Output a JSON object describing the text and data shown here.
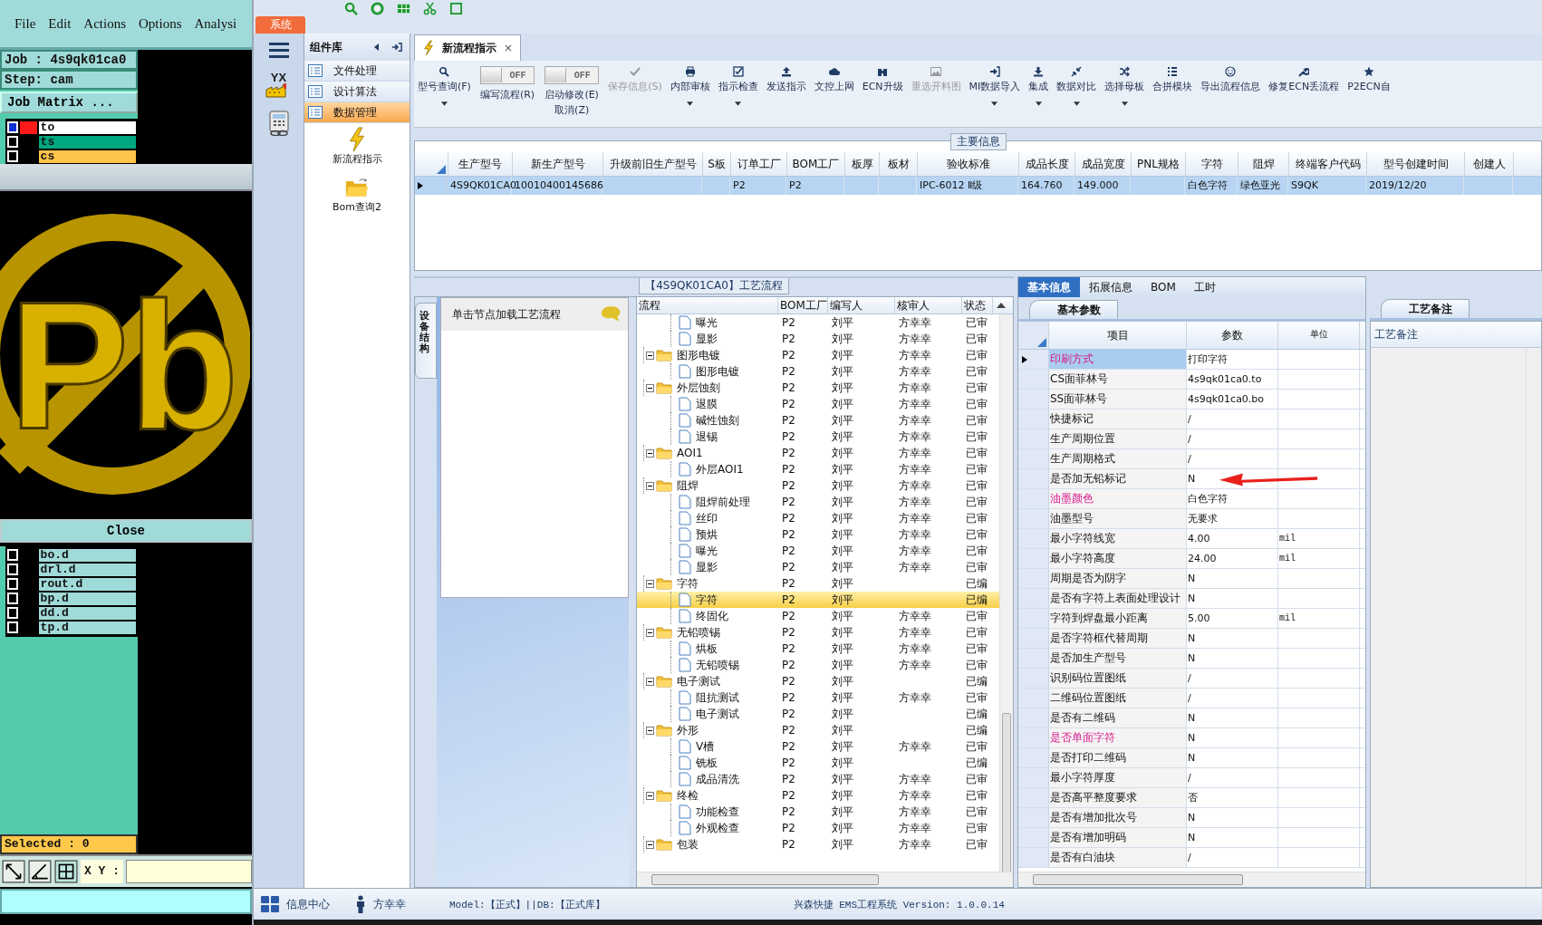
{
  "cam": {
    "menu": [
      "File",
      "Edit",
      "Actions",
      "Options",
      "Analysi"
    ],
    "job": "Job : 4s9qk01ca0",
    "step": "Step: cam",
    "matrix_button": "Job Matrix ...",
    "layers_top": [
      {
        "name": "to",
        "selected": true,
        "color": "#ffffff"
      },
      {
        "name": "ts",
        "selected": false,
        "color": "#00a77f"
      },
      {
        "name": "cs",
        "selected": false,
        "color": "#ffc44a"
      }
    ],
    "canvas_mark": "Pb",
    "close_button": "Close",
    "layers_bottom": [
      {
        "name": "bo.d",
        "selected": false
      },
      {
        "name": "drl.d",
        "selected": false
      },
      {
        "name": "rout.d",
        "selected": false
      },
      {
        "name": "bp.d",
        "selected": false
      },
      {
        "name": "dd.d",
        "selected": false
      },
      {
        "name": "tp.d",
        "selected": false
      }
    ],
    "selected_count": "Selected : 0",
    "xy_label": "X Y :"
  },
  "system_tab": "系统",
  "nav": {
    "logo_text": "YX"
  },
  "library": {
    "title": "组件库",
    "items": [
      {
        "label": "文件处理",
        "selected": false
      },
      {
        "label": "设计算法",
        "selected": false
      },
      {
        "label": "数据管理",
        "selected": true
      }
    ],
    "tools": [
      "新流程指示",
      "Bom查询2"
    ]
  },
  "doc_tab": {
    "title": "新流程指示",
    "close": "×"
  },
  "toolbar": [
    {
      "kind": "button",
      "label": "型号查询(F)",
      "dropdown": true,
      "disabled": false
    },
    {
      "kind": "toggle",
      "label": "编写流程(R)",
      "state_text": "OFF",
      "on": false
    },
    {
      "kind": "toggle",
      "label": "启动修改(E)",
      "sublabel": "取消(Z)",
      "state_text": "OFF",
      "on": false
    },
    {
      "kind": "button",
      "label": "保存信息(S)",
      "dropdown": false,
      "disabled": true
    },
    {
      "kind": "button",
      "label": "内部审核",
      "dropdown": true,
      "disabled": false
    },
    {
      "kind": "button",
      "label": "指示检查",
      "dropdown": true,
      "disabled": false
    },
    {
      "kind": "button",
      "label": "发送指示",
      "dropdown": false,
      "disabled": false
    },
    {
      "kind": "button",
      "label": "文控上网",
      "dropdown": false,
      "disabled": false
    },
    {
      "kind": "button",
      "label": "ECN升级",
      "dropdown": false,
      "disabled": false
    },
    {
      "kind": "button",
      "label": "重选开料图",
      "dropdown": false,
      "disabled": true
    },
    {
      "kind": "button",
      "label": "MI数据导入",
      "dropdown": true,
      "disabled": false
    },
    {
      "kind": "button",
      "label": "集成",
      "dropdown": true,
      "disabled": false
    },
    {
      "kind": "button",
      "label": "数据对比",
      "dropdown": true,
      "disabled": false
    },
    {
      "kind": "button",
      "label": "选择母板",
      "dropdown": true,
      "disabled": false
    },
    {
      "kind": "button",
      "label": "合拼模块",
      "dropdown": false,
      "disabled": false
    },
    {
      "kind": "button",
      "label": "导出流程信息",
      "dropdown": false,
      "disabled": false
    },
    {
      "kind": "button",
      "label": "修复ECN丢流程",
      "dropdown": false,
      "disabled": false
    },
    {
      "kind": "button",
      "label": "P2ECN自",
      "dropdown": false,
      "disabled": false
    }
  ],
  "main_table": {
    "title": "主要信息",
    "columns": [
      "生产型号",
      "新生产型号",
      "升级前旧生产型号",
      "S板",
      "订单工厂",
      "BOM工厂",
      "板厚",
      "板材",
      "验收标准",
      "成品长度",
      "成品宽度",
      "PNL规格",
      "字符",
      "阻焊",
      "终端客户代码",
      "型号创建时间",
      "创建人"
    ],
    "rows": [
      {
        "selected": true,
        "cells": [
          "4S9QK01CA0",
          "10010400145686",
          null,
          null,
          "P2",
          "P2",
          null,
          null,
          "IPC-6012 Ⅱ级",
          "164.760",
          "149.000",
          null,
          "白色字符",
          "绿色亚光",
          "S9QK",
          "2019/12/20",
          null
        ]
      }
    ]
  },
  "process": {
    "title": "【4S9QK01CA0】工艺流程",
    "side_tab": "设备结构",
    "hint": "单击节点加载工艺流程",
    "columns": [
      "流程",
      "BOM工厂",
      "编写人",
      "核审人",
      "状态"
    ],
    "continued": [
      {
        "kind": "step",
        "name": "曝光",
        "bom": "P2",
        "writer": "刘平",
        "reviewer": "方幸幸",
        "status": "已审",
        "selected": false
      },
      {
        "kind": "step",
        "name": "显影",
        "bom": "P2",
        "writer": "刘平",
        "reviewer": "方幸幸",
        "status": "已审",
        "selected": false
      }
    ],
    "nodes": [
      {
        "kind": "group",
        "name": "图形电镀",
        "bom": "P2",
        "writer": "刘平",
        "reviewer": "方幸幸",
        "status": "已审",
        "selected": false,
        "expanded": true,
        "children": [
          {
            "kind": "step",
            "name": "图形电镀",
            "bom": "P2",
            "writer": "刘平",
            "reviewer": "方幸幸",
            "status": "已审",
            "selected": false
          }
        ]
      },
      {
        "kind": "group",
        "name": "外层蚀刻",
        "bom": "P2",
        "writer": "刘平",
        "reviewer": "方幸幸",
        "status": "已审",
        "selected": false,
        "expanded": true,
        "children": [
          {
            "kind": "step",
            "name": "退膜",
            "bom": "P2",
            "writer": "刘平",
            "reviewer": "方幸幸",
            "status": "已审",
            "selected": false
          },
          {
            "kind": "step",
            "name": "碱性蚀刻",
            "bom": "P2",
            "writer": "刘平",
            "reviewer": "方幸幸",
            "status": "已审",
            "selected": false
          },
          {
            "kind": "step",
            "name": "退锡",
            "bom": "P2",
            "writer": "刘平",
            "reviewer": "方幸幸",
            "status": "已审",
            "selected": false
          }
        ]
      },
      {
        "kind": "group",
        "name": "AOI1",
        "bom": "P2",
        "writer": "刘平",
        "reviewer": "方幸幸",
        "status": "已审",
        "selected": false,
        "expanded": true,
        "children": [
          {
            "kind": "step",
            "name": "外层AOI1",
            "bom": "P2",
            "writer": "刘平",
            "reviewer": "方幸幸",
            "status": "已审",
            "selected": false
          }
        ]
      },
      {
        "kind": "group",
        "name": "阻焊",
        "bom": "P2",
        "writer": "刘平",
        "reviewer": "方幸幸",
        "status": "已审",
        "selected": false,
        "expanded": true,
        "children": [
          {
            "kind": "step",
            "name": "阻焊前处理",
            "bom": "P2",
            "writer": "刘平",
            "reviewer": "方幸幸",
            "status": "已审",
            "selected": false
          },
          {
            "kind": "step",
            "name": "丝印",
            "bom": "P2",
            "writer": "刘平",
            "reviewer": "方幸幸",
            "status": "已审",
            "selected": false
          },
          {
            "kind": "step",
            "name": "预烘",
            "bom": "P2",
            "writer": "刘平",
            "reviewer": "方幸幸",
            "status": "已审",
            "selected": false
          },
          {
            "kind": "step",
            "name": "曝光",
            "bom": "P2",
            "writer": "刘平",
            "reviewer": "方幸幸",
            "status": "已审",
            "selected": false
          },
          {
            "kind": "step",
            "name": "显影",
            "bom": "P2",
            "writer": "刘平",
            "reviewer": "方幸幸",
            "status": "已审",
            "selected": false
          }
        ]
      },
      {
        "kind": "group",
        "name": "字符",
        "bom": "P2",
        "writer": "刘平",
        "status": "已编",
        "selected": false,
        "expanded": true,
        "children": [
          {
            "kind": "step",
            "name": "字符",
            "bom": "P2",
            "writer": "刘平",
            "status": "已编",
            "selected": true
          },
          {
            "kind": "step",
            "name": "终固化",
            "bom": "P2",
            "writer": "刘平",
            "reviewer": "方幸幸",
            "status": "已审",
            "selected": false
          }
        ]
      },
      {
        "kind": "group",
        "name": "无铅喷锡",
        "bom": "P2",
        "writer": "刘平",
        "reviewer": "方幸幸",
        "status": "已审",
        "selected": false,
        "expanded": true,
        "children": [
          {
            "kind": "step",
            "name": "烘板",
            "bom": "P2",
            "writer": "刘平",
            "reviewer": "方幸幸",
            "status": "已审",
            "selected": false
          },
          {
            "kind": "step",
            "name": "无铅喷锡",
            "bom": "P2",
            "writer": "刘平",
            "reviewer": "方幸幸",
            "status": "已审",
            "selected": false
          }
        ]
      },
      {
        "kind": "group",
        "name": "电子测试",
        "bom": "P2",
        "writer": "刘平",
        "status": "已编",
        "selected": false,
        "expanded": true,
        "children": [
          {
            "kind": "step",
            "name": "阻抗测试",
            "bom": "P2",
            "writer": "刘平",
            "reviewer": "方幸幸",
            "status": "已审",
            "selected": false
          },
          {
            "kind": "step",
            "name": "电子测试",
            "bom": "P2",
            "writer": "刘平",
            "status": "已编",
            "selected": false
          }
        ]
      },
      {
        "kind": "group",
        "name": "外形",
        "bom": "P2",
        "writer": "刘平",
        "status": "已编",
        "selected": false,
        "expanded": true,
        "children": [
          {
            "kind": "step",
            "name": "V槽",
            "bom": "P2",
            "writer": "刘平",
            "reviewer": "方幸幸",
            "status": "已审",
            "selected": false
          },
          {
            "kind": "step",
            "name": "铣板",
            "bom": "P2",
            "writer": "刘平",
            "status": "已编",
            "selected": false
          },
          {
            "kind": "step",
            "name": "成品清洗",
            "bom": "P2",
            "writer": "刘平",
            "reviewer": "方幸幸",
            "status": "已审",
            "selected": false
          }
        ]
      },
      {
        "kind": "group",
        "name": "终检",
        "bom": "P2",
        "writer": "刘平",
        "reviewer": "方幸幸",
        "status": "已审",
        "selected": false,
        "expanded": true,
        "children": [
          {
            "kind": "step",
            "name": "功能检查",
            "bom": "P2",
            "writer": "刘平",
            "reviewer": "方幸幸",
            "status": "已审",
            "selected": false
          },
          {
            "kind": "step",
            "name": "外观检查",
            "bom": "P2",
            "writer": "刘平",
            "reviewer": "方幸幸",
            "status": "已审",
            "selected": false
          }
        ]
      },
      {
        "kind": "group",
        "name": "包装",
        "bom": "P2",
        "writer": "刘平",
        "reviewer": "方幸幸",
        "status": "已审",
        "selected": false,
        "expanded": true
      }
    ]
  },
  "props": {
    "tabs": [
      {
        "label": "基本信息",
        "selected": true
      },
      {
        "label": "拓展信息",
        "selected": false
      },
      {
        "label": "BOM",
        "selected": false
      },
      {
        "label": "工时",
        "selected": false
      }
    ],
    "subtab": "基本参数",
    "columns": [
      "项目",
      "参数",
      "单位"
    ],
    "rows": [
      {
        "item": "印刷方式",
        "value": "打印字符",
        "flagged": true,
        "selected": true,
        "marked": false
      },
      {
        "item": "CS面菲林号",
        "value": "4s9qk01ca0.to",
        "flagged": false,
        "selected": false,
        "marked": false
      },
      {
        "item": "SS面菲林号",
        "value": "4s9qk01ca0.bo",
        "flagged": false,
        "selected": false,
        "marked": false
      },
      {
        "item": "快捷标记",
        "value": "/",
        "flagged": false,
        "selected": false,
        "marked": false
      },
      {
        "item": "生产周期位置",
        "value": "/",
        "flagged": false,
        "selected": false,
        "marked": false
      },
      {
        "item": "生产周期格式",
        "value": "/",
        "flagged": false,
        "selected": false,
        "marked": false
      },
      {
        "item": "是否加无铅标记",
        "value": "N",
        "flagged": false,
        "selected": false,
        "marked": true
      },
      {
        "item": "油墨颜色",
        "value": "白色字符",
        "flagged": true,
        "selected": false,
        "marked": false
      },
      {
        "item": "油墨型号",
        "value": "无要求",
        "flagged": false,
        "selected": false,
        "marked": false
      },
      {
        "item": "最小字符线宽",
        "value": "4.00",
        "unit": "mil",
        "flagged": false,
        "selected": false,
        "marked": false
      },
      {
        "item": "最小字符高度",
        "value": "24.00",
        "unit": "mil",
        "flagged": false,
        "selected": false,
        "marked": false
      },
      {
        "item": "周期是否为阴字",
        "value": "N",
        "flagged": false,
        "selected": false,
        "marked": false
      },
      {
        "item": "是否有字符上表面处理设计",
        "value": "N",
        "flagged": false,
        "selected": false,
        "marked": false
      },
      {
        "item": "字符到焊盘最小距离",
        "value": "5.00",
        "unit": "mil",
        "flagged": false,
        "selected": false,
        "marked": false
      },
      {
        "item": "是否字符框代替周期",
        "value": "N",
        "flagged": false,
        "selected": false,
        "marked": false
      },
      {
        "item": "是否加生产型号",
        "value": "N",
        "flagged": false,
        "selected": false,
        "marked": false
      },
      {
        "item": "识别码位置图纸",
        "value": "/",
        "flagged": false,
        "selected": false,
        "marked": false
      },
      {
        "item": "二维码位置图纸",
        "value": "/",
        "flagged": false,
        "selected": false,
        "marked": false
      },
      {
        "item": "是否有二维码",
        "value": "N",
        "flagged": false,
        "selected": false,
        "marked": false
      },
      {
        "item": "是否单面字符",
        "value": "N",
        "flagged": true,
        "selected": false,
        "marked": false
      },
      {
        "item": "是否打印二维码",
        "value": "N",
        "flagged": false,
        "selected": false,
        "marked": false
      },
      {
        "item": "最小字符厚度",
        "value": "/",
        "flagged": false,
        "selected": false,
        "marked": false
      },
      {
        "item": "是否高平整度要求",
        "value": "否",
        "flagged": false,
        "selected": false,
        "marked": false
      },
      {
        "item": "是否有增加批次号",
        "value": "N",
        "flagged": false,
        "selected": false,
        "marked": false
      },
      {
        "item": "是否有增加明码",
        "value": "N",
        "flagged": false,
        "selected": false,
        "marked": false
      },
      {
        "item": "是否有白油块",
        "value": "/",
        "flagged": false,
        "selected": false,
        "marked": false
      }
    ]
  },
  "notes": {
    "tab": "工艺备注",
    "column": "工艺备注"
  },
  "status": {
    "info": "信息中心",
    "user": "方幸幸",
    "model": "Model:【正式】||DB:【正式库】",
    "version": "兴森快捷 EMS工程系统 Version: 1.0.0.14"
  }
}
